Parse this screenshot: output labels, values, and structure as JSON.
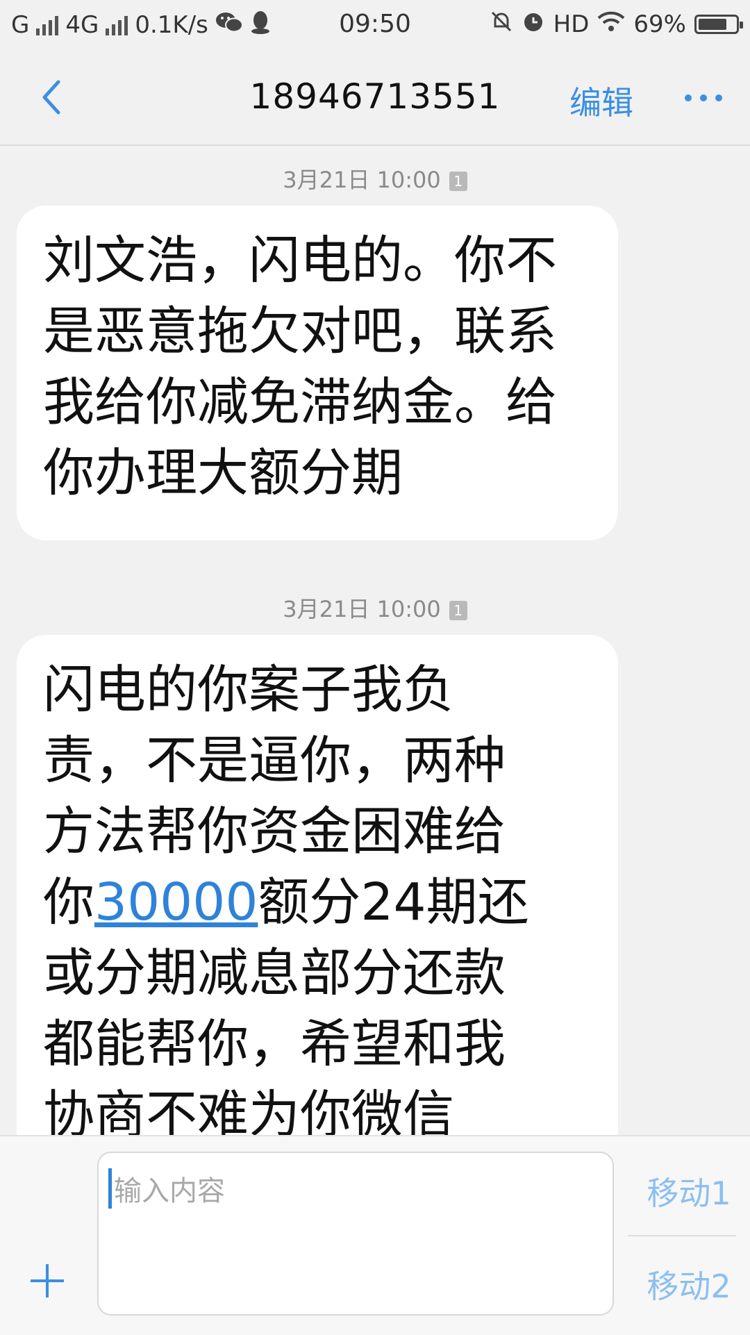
{
  "statusbar": {
    "carrier1": "G",
    "network": "4G",
    "speed": "0.1K/s",
    "time": "09:50",
    "hd": "HD",
    "battery": "69%"
  },
  "header": {
    "title": "18946713551",
    "edit_label": "编辑"
  },
  "messages": [
    {
      "timestamp": "3月21日 10:00",
      "sim": "1",
      "text": "刘文浩，闪电的。你不是恶意拖欠对吧，联系我给你减免滞纳金。给你办理大额分期"
    },
    {
      "timestamp": "3月21日 10:00",
      "sim": "1",
      "text_before": "闪电的你案子我负责，不是逼你，两种方法帮你资金困难给你",
      "link_number": "30000",
      "text_after": "额分24期还或分期减息部分还款都能帮你，希望和我协商不难为你微信"
    }
  ],
  "composer": {
    "placeholder": "输入内容",
    "send1_label": "移动1",
    "send2_label": "移动2"
  },
  "colors": {
    "accent": "#3a8fe3",
    "link": "#2f82d9",
    "send_disabled": "#8cbff0"
  }
}
